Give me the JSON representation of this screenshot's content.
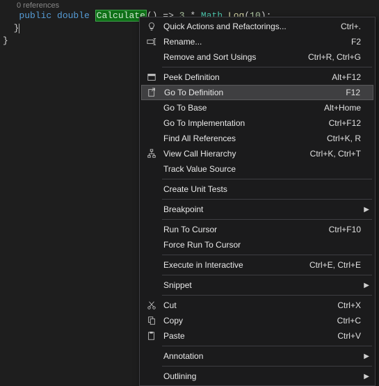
{
  "codelens": "0 references",
  "code": {
    "kw_public": "public",
    "kw_double": "double",
    "method": "Calculate",
    "parens": "()",
    "arrow": " => ",
    "num1": "3",
    "star": " * ",
    "mathType": "Math",
    "dot": ".",
    "logCall": "Log",
    "open": "(",
    "num2": "10",
    "close": ")",
    "semi": ";"
  },
  "brace1": "  }",
  "brace2": "}",
  "menu": {
    "items": [
      {
        "id": "quick-actions",
        "label": "Quick Actions and Refactorings...",
        "shortcut": "Ctrl+.",
        "icon": "bulb"
      },
      {
        "id": "rename",
        "label": "Rename...",
        "shortcut": "F2",
        "icon": "rename"
      },
      {
        "id": "remove-sort-usings",
        "label": "Remove and Sort Usings",
        "shortcut": "Ctrl+R, Ctrl+G",
        "icon": ""
      },
      {
        "sep": true
      },
      {
        "id": "peek-definition",
        "label": "Peek Definition",
        "shortcut": "Alt+F12",
        "icon": "peek"
      },
      {
        "id": "goto-definition",
        "label": "Go To Definition",
        "shortcut": "F12",
        "icon": "goto",
        "highlighted": true
      },
      {
        "id": "goto-base",
        "label": "Go To Base",
        "shortcut": "Alt+Home",
        "icon": ""
      },
      {
        "id": "goto-impl",
        "label": "Go To Implementation",
        "shortcut": "Ctrl+F12",
        "icon": ""
      },
      {
        "id": "find-refs",
        "label": "Find All References",
        "shortcut": "Ctrl+K, R",
        "icon": ""
      },
      {
        "id": "call-hierarchy",
        "label": "View Call Hierarchy",
        "shortcut": "Ctrl+K, Ctrl+T",
        "icon": "hierarchy"
      },
      {
        "id": "track-value",
        "label": "Track Value Source",
        "shortcut": "",
        "icon": ""
      },
      {
        "sep": true
      },
      {
        "id": "create-unit-tests",
        "label": "Create Unit Tests",
        "shortcut": "",
        "icon": ""
      },
      {
        "sep": true
      },
      {
        "id": "breakpoint",
        "label": "Breakpoint",
        "shortcut": "",
        "icon": "",
        "submenu": true
      },
      {
        "sep": true
      },
      {
        "id": "run-to-cursor",
        "label": "Run To Cursor",
        "shortcut": "Ctrl+F10",
        "icon": ""
      },
      {
        "id": "force-run-to-cursor",
        "label": "Force Run To Cursor",
        "shortcut": "",
        "icon": ""
      },
      {
        "sep": true
      },
      {
        "id": "exec-interactive",
        "label": "Execute in Interactive",
        "shortcut": "Ctrl+E, Ctrl+E",
        "icon": ""
      },
      {
        "sep": true
      },
      {
        "id": "snippet",
        "label": "Snippet",
        "shortcut": "",
        "icon": "",
        "submenu": true
      },
      {
        "sep": true
      },
      {
        "id": "cut",
        "label": "Cut",
        "shortcut": "Ctrl+X",
        "icon": "cut"
      },
      {
        "id": "copy",
        "label": "Copy",
        "shortcut": "Ctrl+C",
        "icon": "copy"
      },
      {
        "id": "paste",
        "label": "Paste",
        "shortcut": "Ctrl+V",
        "icon": "paste"
      },
      {
        "sep": true
      },
      {
        "id": "annotation",
        "label": "Annotation",
        "shortcut": "",
        "icon": "",
        "submenu": true
      },
      {
        "sep": true
      },
      {
        "id": "outlining",
        "label": "Outlining",
        "shortcut": "",
        "icon": "",
        "submenu": true
      }
    ]
  }
}
